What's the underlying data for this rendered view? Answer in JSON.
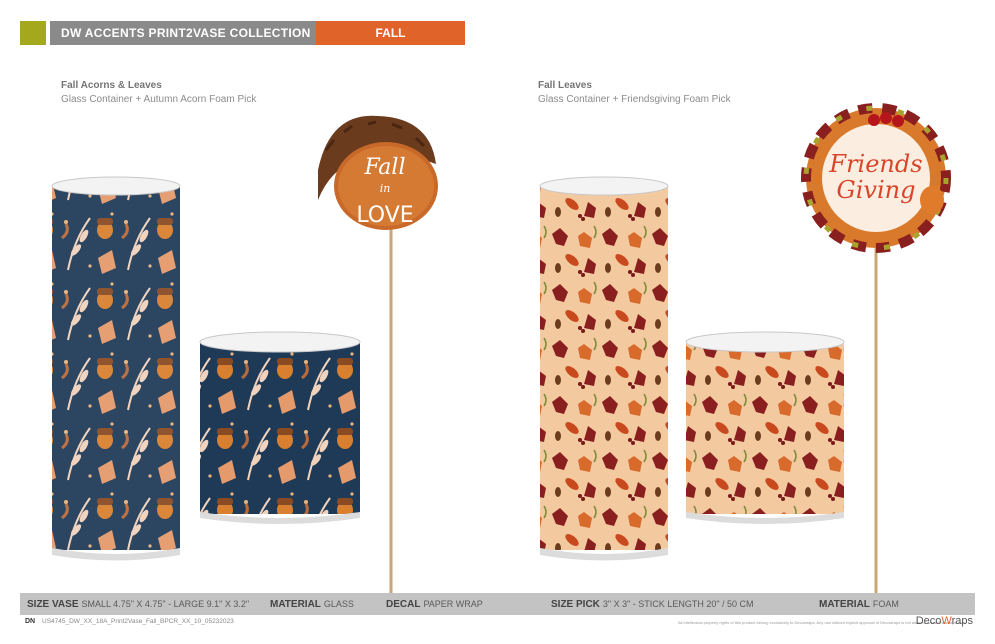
{
  "header": {
    "collection_title": "DW ACCENTS PRINT2VASE COLLECTION",
    "season_tag": "FALL"
  },
  "products": [
    {
      "title": "Fall Acorns & Leaves",
      "subtitle": "Glass Container + Autumn Acorn Foam Pick",
      "pick_text": [
        "Fall",
        "in",
        "LOVE"
      ]
    },
    {
      "title": "Fall Leaves",
      "subtitle": "Glass Container + Friendsgiving Foam Pick",
      "pick_text": [
        "Friends",
        "Giving"
      ]
    }
  ],
  "specs": {
    "size_vase_label": "SIZE VASE",
    "size_vase_value": "SMALL 4.75\" X 4.75\" - LARGE 9.1\" X 3.2\"",
    "material1_label": "MATERIAL",
    "material1_value": "GLASS",
    "decal_label": "DECAL",
    "decal_value": "PAPER WRAP",
    "size_pick_label": "SIZE PICK",
    "size_pick_value": "3\" X 3\" - STICK LENGTH 20\" / 50 CM",
    "material2_label": "MATERIAL",
    "material2_value": "FOAM"
  },
  "footer": {
    "dn_label": "DN",
    "code": "US4745_DW_XX_18A_Print2Vase_Fall_BPCR_XX_10_05232023",
    "legal": "All intellectual property rights of this product belong exclusively to Decowraps. Any use without explicit approval of Decowraps is not allowed.  www.decowraps.com",
    "brand_pre": "Deco",
    "brand_accent": "W",
    "brand_post": "raps"
  },
  "colors": {
    "olive": "#a3a81d",
    "header_gray": "#8a8a8a",
    "accent_orange": "#e0632a",
    "navy_wrap": "#1f3a57",
    "peach_wrap": "#f3c9a0",
    "spec_bar": "#c3c3c3"
  }
}
